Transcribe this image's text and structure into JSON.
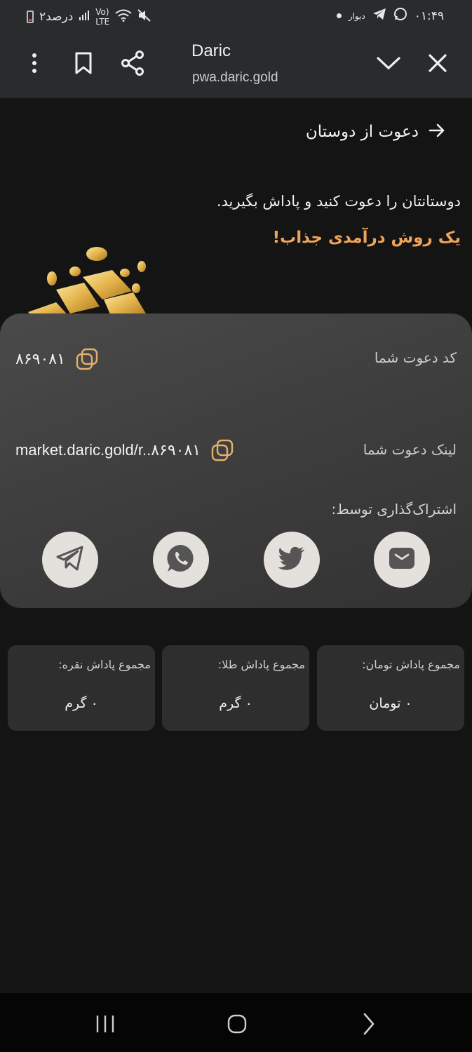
{
  "status_bar": {
    "battery_text": "۲درصد",
    "network": "LTE",
    "network_small": "Vo)",
    "app_label": "دیوار",
    "time": "۰۱:۴۹"
  },
  "browser": {
    "title": "Daric",
    "url": "pwa.daric.gold"
  },
  "page": {
    "title": "دعوت از دوستان",
    "intro": "دوستانتان را دعوت کنید و پاداش بگیرید.",
    "intro_accent": "یک روش درآمدی جذاب!",
    "accent_color": "#f0a45a"
  },
  "invite_card": {
    "code_label": "کد دعوت شما",
    "code_value": "۸۶۹۰۸۱",
    "link_label": "لینک دعوت شما",
    "link_value": "market.daric.gold/r..۸۶۹۰۸۱",
    "share_label": "اشتراک‌گذاری توسط:",
    "share_targets": [
      "email-icon",
      "twitter-icon",
      "whatsapp-icon",
      "telegram-icon"
    ]
  },
  "stats": [
    {
      "label": "مجموع پاداش تومان:",
      "value": "۰ تومان"
    },
    {
      "label": "مجموع پاداش طلا:",
      "value": "۰ گرم"
    },
    {
      "label": "مجموع پاداش نقره:",
      "value": "۰ گرم"
    }
  ]
}
